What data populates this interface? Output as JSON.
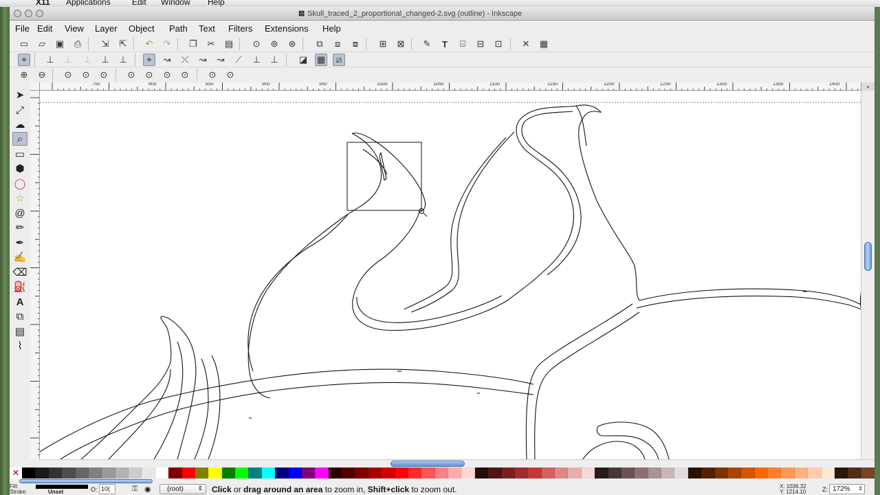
{
  "mac_menu": {
    "apple": "",
    "x11": "X11",
    "applications": "Applications",
    "edit": "Edit",
    "window": "Window",
    "help": "Help"
  },
  "window": {
    "title": "Skull_traced_2_proportional_changed-2.svg (outline) - Inkscape"
  },
  "menubar": [
    "File",
    "Edit",
    "View",
    "Layer",
    "Object",
    "Path",
    "Text",
    "Filters",
    "Extensions",
    "Help"
  ],
  "ruler": {
    "labels": [
      "750",
      "800",
      "850",
      "900",
      "950",
      "1000",
      "1050",
      "1100",
      "1150",
      "1200",
      "1250",
      "1300",
      "1350",
      "1400"
    ]
  },
  "palette": [
    "#000000",
    "#1a1a1a",
    "#333333",
    "#4d4d4d",
    "#666666",
    "#808080",
    "#999999",
    "#b3b3b3",
    "#cccccc",
    "#e6e6e6",
    "#ffffff",
    "#800000",
    "#ff0000",
    "#808000",
    "#ffff00",
    "#008000",
    "#00ff00",
    "#008080",
    "#00ffff",
    "#000080",
    "#0000ff",
    "#800080",
    "#ff00ff",
    "#2b0000",
    "#550000",
    "#800000",
    "#aa0000",
    "#d40000",
    "#ff0000",
    "#ff2a2a",
    "#ff5555",
    "#ff8080",
    "#ffaaaa",
    "#ffd5d5",
    "#280b0b",
    "#501616",
    "#782121",
    "#a02c2c",
    "#c83737",
    "#d35f5f",
    "#de8787",
    "#e9afaf",
    "#f4d7d7",
    "#241c1c",
    "#483737",
    "#6c5353",
    "#916f6f",
    "#ac9393",
    "#c8b7b7",
    "#e3dbdb",
    "#2b1100",
    "#552200",
    "#803300",
    "#aa4400",
    "#d45500",
    "#ff6600",
    "#ff7f2a",
    "#ff9955",
    "#ffb380",
    "#ffccaa",
    "#ffe6d5",
    "#28170b",
    "#502d16",
    "#784421"
  ],
  "status": {
    "fill_label": "Fill:",
    "stroke_label": "Stroke:",
    "stroke_value": "Unset",
    "opacity_label": "O:",
    "opacity_value": "10(",
    "layer": "(root)",
    "msg_click": "Click",
    "msg_or": " or ",
    "msg_drag": "drag around an area",
    "msg_zoomin": " to zoom in, ",
    "msg_shift": "Shift+click",
    "msg_zoomout": " to zoom out.",
    "coord_x": "X: 1036.32",
    "coord_y": "Y: 1214.10",
    "zoom_label": "Z:",
    "zoom_value": "172%"
  },
  "icons": {
    "tools": [
      "selector-icon",
      "node-icon",
      "tweak-icon",
      "zoom-icon",
      "rect-icon",
      "3dbox-icon",
      "ellipse-icon",
      "star-icon",
      "spiral-icon",
      "pencil-icon",
      "pen-icon",
      "calligraphy-icon",
      "eraser-icon",
      "paint-bucket-icon",
      "text-icon",
      "connector-icon",
      "gradient-icon",
      "dropper-icon"
    ]
  }
}
